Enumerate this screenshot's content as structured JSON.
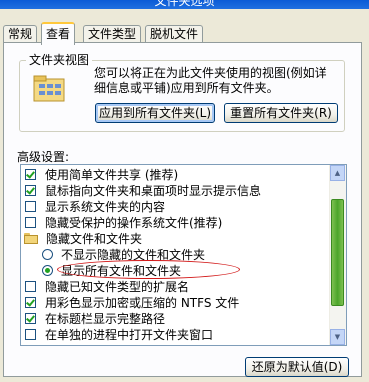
{
  "window": {
    "title": "文件夹选项"
  },
  "tabs": [
    {
      "label": "常规"
    },
    {
      "label": "查看"
    },
    {
      "label": "文件类型"
    },
    {
      "label": "脱机文件"
    }
  ],
  "folder_views": {
    "title": "文件夹视图",
    "description": "您可以将正在为此文件夹使用的视图(例如详细信息或平铺)应用到所有文件夹。",
    "apply_button": "应用到所有文件夹(L)",
    "reset_button": "重置所有文件夹(R)"
  },
  "advanced": {
    "label": "高级设置:",
    "items": [
      {
        "type": "checkbox",
        "checked": true,
        "label": "使用简单文件共享 (推荐)"
      },
      {
        "type": "checkbox",
        "checked": true,
        "label": "鼠标指向文件夹和桌面项时显示提示信息"
      },
      {
        "type": "checkbox",
        "checked": false,
        "label": "显示系统文件夹的内容"
      },
      {
        "type": "checkbox",
        "checked": false,
        "label": "隐藏受保护的操作系统文件(推荐)"
      },
      {
        "type": "folder",
        "label": "隐藏文件和文件夹"
      },
      {
        "type": "radio",
        "checked": false,
        "label": "不显示隐藏的文件和文件夹"
      },
      {
        "type": "radio",
        "checked": true,
        "label": "显示所有文件和文件夹"
      },
      {
        "type": "checkbox",
        "checked": false,
        "label": "隐藏已知文件类型的扩展名"
      },
      {
        "type": "checkbox",
        "checked": true,
        "label": "用彩色显示加密或压缩的 NTFS 文件"
      },
      {
        "type": "checkbox",
        "checked": true,
        "label": "在标题栏显示完整路径"
      },
      {
        "type": "checkbox",
        "checked": false,
        "label": "在单独的进程中打开文件夹窗口"
      }
    ]
  },
  "restore_button": "还原为默认值(D)"
}
